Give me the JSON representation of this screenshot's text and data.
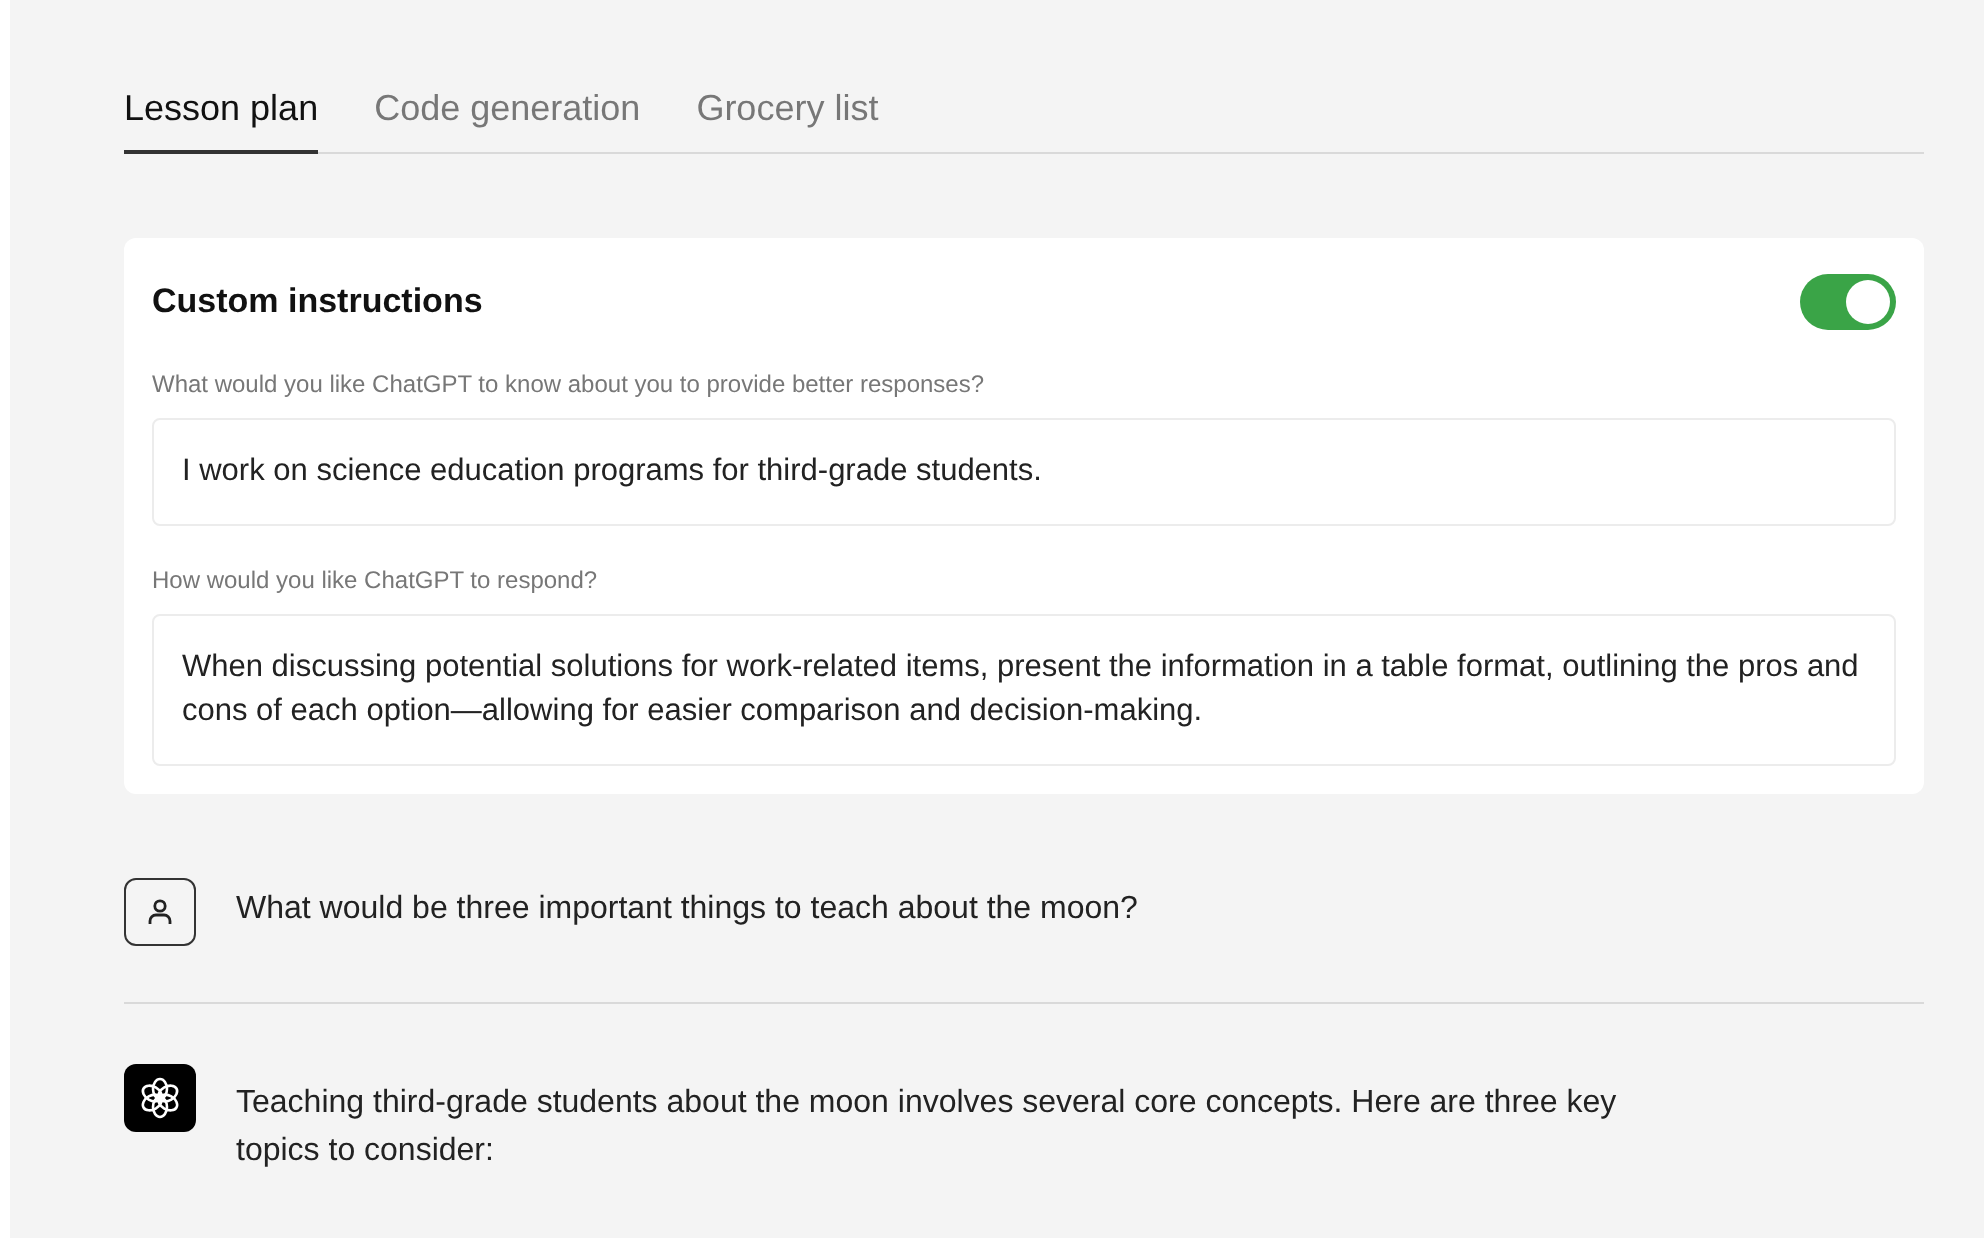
{
  "tabs": [
    {
      "label": "Lesson plan",
      "selected": true
    },
    {
      "label": "Code generation",
      "selected": false
    },
    {
      "label": "Grocery list",
      "selected": false
    }
  ],
  "custom_instructions": {
    "title": "Custom instructions",
    "on": true,
    "fields": [
      {
        "label": "What would you like ChatGPT to know about you to provide better responses?",
        "value": "I work on science education programs for third-grade students."
      },
      {
        "label": "How would you like ChatGPT to respond?",
        "value": "When discussing potential solutions for work-related items, present the information in a table format, outlining the pros and cons of each option—allowing for easier comparison and decision-making."
      }
    ]
  },
  "messages": [
    {
      "kind": "user",
      "text": "What would be three important things to teach about the moon?"
    },
    {
      "kind": "assistant",
      "text": "Teaching third-grade students about the moon involves several core concepts. Here are three key topics to consider:"
    }
  ]
}
